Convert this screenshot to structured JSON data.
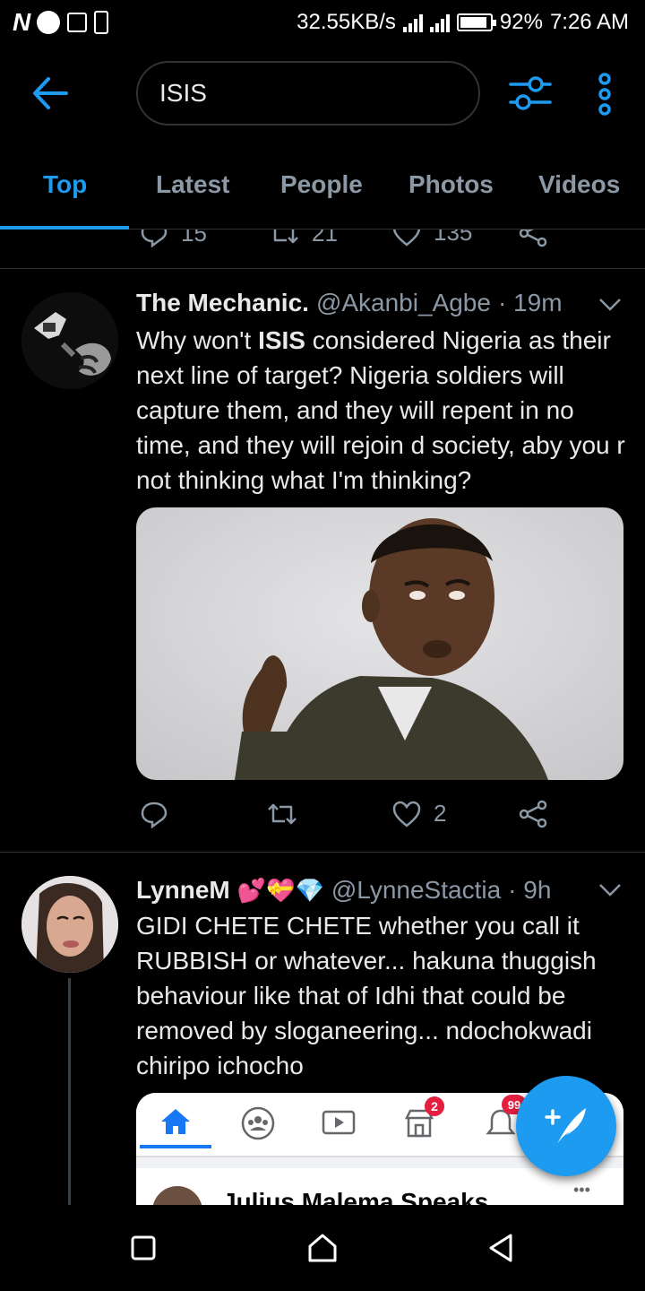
{
  "status_bar": {
    "carrier_letter": "N",
    "speed": "32.55KB/s",
    "battery": "92%",
    "time": "7:26 AM"
  },
  "search": {
    "query": "ISIS"
  },
  "tabs": [
    {
      "label": "Top",
      "active": true
    },
    {
      "label": "Latest"
    },
    {
      "label": "People"
    },
    {
      "label": "Photos"
    },
    {
      "label": "Videos"
    }
  ],
  "previous_tweet": {
    "replies": "15",
    "retweets": "21",
    "likes": "135"
  },
  "tweets": [
    {
      "name": "The Mechanic.",
      "handle": "@Akanbi_Agbe",
      "time": "· 19m",
      "text_before": "Why won't ",
      "text_highlight": "ISIS",
      "text_after": " considered Nigeria as their next line of target? Nigeria soldiers will capture them, and they will repent in no time, and they will rejoin d society, aby you r not thinking what I'm thinking?",
      "likes": "2"
    },
    {
      "name": "LynneM",
      "name_emojis": "💕💝💎",
      "handle": "@LynneStactia",
      "time": "· 9h",
      "text": "GIDI CHETE CHETE whether you call it RUBBISH or whatever... hakuna thuggish behaviour like that of Idhi that could be removed by sloganeering... ndochokwadi chiripo ichocho",
      "embedded": {
        "badge_marketplace": "2",
        "badge_notifications": "99",
        "post_author": "Julius Malema Speaks",
        "post_more": "•••"
      }
    }
  ],
  "colors": {
    "accent": "#1d9bf0",
    "background": "#000000",
    "secondary_text": "#8b98a5",
    "divider": "#2f3336"
  }
}
